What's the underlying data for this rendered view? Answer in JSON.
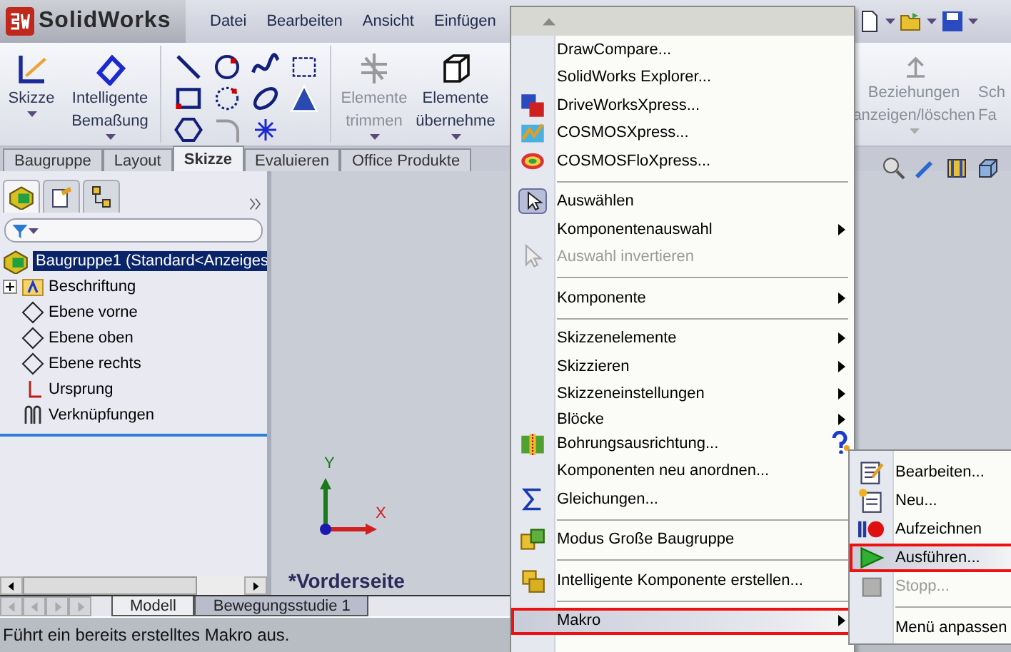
{
  "app": {
    "logo": "SolidWorks"
  },
  "menubar": [
    {
      "label": "Datei"
    },
    {
      "label": "Bearbeiten"
    },
    {
      "label": "Ansicht"
    },
    {
      "label": "Einfügen"
    }
  ],
  "ribbon_buttons": [
    {
      "kind": "large",
      "lines": [
        "Skizze"
      ],
      "disabled": false
    },
    {
      "kind": "large",
      "lines": [
        "Intelligente",
        "Bemaßung"
      ],
      "disabled": false
    },
    {
      "kind": "tools"
    },
    {
      "kind": "large",
      "lines": [
        "Elemente",
        "trimmen"
      ],
      "disabled": true
    },
    {
      "kind": "large",
      "lines": [
        "Elemente",
        "übernehme"
      ],
      "disabled": false
    }
  ],
  "ribbon_right": [
    {
      "lines": [
        "Beziehungen",
        "anzeigen/löschen"
      ],
      "disabled": true
    },
    {
      "lines": [
        "Sch",
        "Fa"
      ],
      "disabled": true
    }
  ],
  "command_tabs": [
    {
      "label": "Baugruppe",
      "selected": false
    },
    {
      "label": "Layout",
      "selected": false
    },
    {
      "label": "Skizze",
      "selected": true
    },
    {
      "label": "Evaluieren",
      "selected": false
    },
    {
      "label": "Office Produkte",
      "selected": false
    }
  ],
  "panel_tabs": [
    {
      "selected": true
    },
    {
      "selected": false
    },
    {
      "selected": false
    }
  ],
  "feature_tree": {
    "root": {
      "label": "Baugruppe1  (Standard<Anzeiges",
      "selected": true
    },
    "items": [
      {
        "kind": "folder",
        "label": "Beschriftung",
        "expanded": false
      },
      {
        "kind": "plane",
        "label": "Ebene vorne"
      },
      {
        "kind": "plane",
        "label": "Ebene oben"
      },
      {
        "kind": "plane",
        "label": "Ebene rechts"
      },
      {
        "kind": "origin",
        "label": "Ursprung"
      },
      {
        "kind": "mates",
        "label": "Verknüpfungen"
      }
    ]
  },
  "viewport": {
    "view_name": "*Vorderseite",
    "axis_x": "X",
    "axis_y": "Y"
  },
  "bottom_tabs": [
    {
      "label": "Modell",
      "selected": true
    },
    {
      "label": "Bewegungsstudie 1",
      "selected": false
    }
  ],
  "status_bar": {
    "message": "Führt ein bereits erstelltes Makro aus."
  },
  "menu": {
    "items": [
      {
        "kind": "item",
        "label": "DrawCompare...",
        "submenu": false,
        "disabled": false,
        "selected": false,
        "marked": false
      },
      {
        "kind": "item",
        "label": "SolidWorks Explorer...",
        "submenu": false,
        "disabled": false,
        "selected": false,
        "marked": false
      },
      {
        "kind": "item",
        "label": "DriveWorksXpress...",
        "submenu": false,
        "disabled": false,
        "selected": false,
        "marked": false
      },
      {
        "kind": "item",
        "label": "COSMOSXpress...",
        "submenu": false,
        "disabled": false,
        "selected": false,
        "marked": false
      },
      {
        "kind": "item",
        "label": "COSMOSFloXpress...",
        "submenu": false,
        "disabled": false,
        "selected": false,
        "marked": false
      },
      {
        "kind": "separator"
      },
      {
        "kind": "item",
        "label": "Auswählen",
        "submenu": false,
        "disabled": false,
        "selected": false,
        "marked": false
      },
      {
        "kind": "item",
        "label": "Komponentenauswahl",
        "submenu": true,
        "disabled": false,
        "selected": false,
        "marked": false
      },
      {
        "kind": "item",
        "label": "Auswahl invertieren",
        "submenu": false,
        "disabled": true,
        "selected": false,
        "marked": false
      },
      {
        "kind": "separator"
      },
      {
        "kind": "item",
        "label": "Komponente",
        "submenu": true,
        "disabled": false,
        "selected": false,
        "marked": false
      },
      {
        "kind": "separator"
      },
      {
        "kind": "item",
        "label": "Skizzenelemente",
        "submenu": true,
        "disabled": false,
        "selected": false,
        "marked": false
      },
      {
        "kind": "item",
        "label": "Skizzieren",
        "submenu": true,
        "disabled": false,
        "selected": false,
        "marked": false
      },
      {
        "kind": "item",
        "label": "Skizzeneinstellungen",
        "submenu": true,
        "disabled": false,
        "selected": false,
        "marked": false
      },
      {
        "kind": "item",
        "label": "Blöcke",
        "submenu": true,
        "disabled": false,
        "selected": false,
        "marked": false
      },
      {
        "kind": "item",
        "label": "Bohrungsausrichtung...",
        "submenu": false,
        "disabled": false,
        "selected": false,
        "marked": false
      },
      {
        "kind": "item",
        "label": "Komponenten neu anordnen...",
        "submenu": false,
        "disabled": false,
        "selected": false,
        "marked": false
      },
      {
        "kind": "item",
        "label": "Gleichungen...",
        "submenu": false,
        "disabled": false,
        "selected": false,
        "marked": false
      },
      {
        "kind": "separator"
      },
      {
        "kind": "item",
        "label": "Modus Große Baugruppe",
        "submenu": false,
        "disabled": false,
        "selected": false,
        "marked": false
      },
      {
        "kind": "separator"
      },
      {
        "kind": "item",
        "label": "Intelligente Komponente erstellen...",
        "submenu": false,
        "disabled": false,
        "selected": false,
        "marked": false
      },
      {
        "kind": "separator"
      },
      {
        "kind": "item",
        "label": "Makro",
        "submenu": true,
        "disabled": false,
        "selected": true,
        "marked": true
      }
    ]
  },
  "submenu": {
    "items": [
      {
        "kind": "item",
        "label": "Bearbeiten...",
        "disabled": false,
        "selected": false,
        "marked": false
      },
      {
        "kind": "item",
        "label": "Neu...",
        "disabled": false,
        "selected": false,
        "marked": false
      },
      {
        "kind": "item",
        "label": "Aufzeichnen",
        "disabled": false,
        "selected": false,
        "marked": false
      },
      {
        "kind": "item",
        "label": "Ausführen...",
        "disabled": false,
        "selected": true,
        "marked": true
      },
      {
        "kind": "item",
        "label": "Stopp...",
        "disabled": true,
        "selected": false,
        "marked": false
      },
      {
        "kind": "separator"
      },
      {
        "kind": "item",
        "label": "Menü anpassen",
        "disabled": false,
        "selected": false,
        "marked": false
      }
    ]
  }
}
